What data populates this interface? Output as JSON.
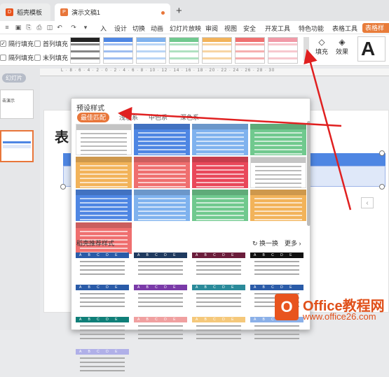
{
  "tabs": [
    {
      "label": "稻壳模板",
      "icon": "docer-icon"
    },
    {
      "label": "演示文稿1",
      "icon": "presentation-icon"
    }
  ],
  "menu": {
    "items": [
      "入",
      "设计",
      "切换",
      "动画",
      "幻灯片放映",
      "审阅",
      "视图",
      "安全",
      "开发工具",
      "特色功能",
      "表格工具",
      "表格样"
    ]
  },
  "ribbon": {
    "checkboxes": [
      {
        "label": "隔行填充",
        "checked": true
      },
      {
        "label": "首列填充",
        "checked": false
      },
      {
        "label": "隔列填充",
        "checked": false
      },
      {
        "label": "末列填充",
        "checked": false
      }
    ],
    "swatch_colors": [
      "#222222",
      "#4e86e3",
      "#7fb2ee",
      "#70c98e",
      "#f2b35a",
      "#ef6f6f",
      "#f19aa8"
    ],
    "fill_label": "填充",
    "effect_label": "效果",
    "font_big": "A"
  },
  "left_panel": {
    "tag": "幻灯片",
    "thumb_text": "击演示"
  },
  "slide": {
    "title": "表"
  },
  "popup": {
    "title": "预设样式",
    "filters": [
      "最佳匹配",
      "浅色系",
      "中色系",
      "深色系"
    ],
    "styles": [
      [
        "#ffffff",
        "#4e86e3",
        "#7fb2ee",
        "#70c98e"
      ],
      [
        "#f2b35a",
        "#ef6f6f",
        "#e9485a",
        "#ffffff"
      ],
      [
        "#4e86e3",
        "#7fb2ee",
        "#70c98e",
        "#f2b35a"
      ],
      [
        "#ef6f6f"
      ]
    ],
    "rec_title": "稻壳推荐样式",
    "rec_refresh": "换一换",
    "rec_more": "更多",
    "rec_colors": [
      "#2a5ba8",
      "#1f3a5f",
      "#6b1d3b",
      "#111111",
      "#2a5ba8",
      "#7a3aa8",
      "#2a8a9a",
      "#2a5ba8",
      "#0f7f78",
      "#f0a0a0",
      "#f5c87a",
      "#8bb0e8",
      "#b0b0e8"
    ],
    "rec_letters": "A B C D E"
  },
  "watermark": {
    "brand": "Office教程网",
    "site": "www.office26.com"
  }
}
